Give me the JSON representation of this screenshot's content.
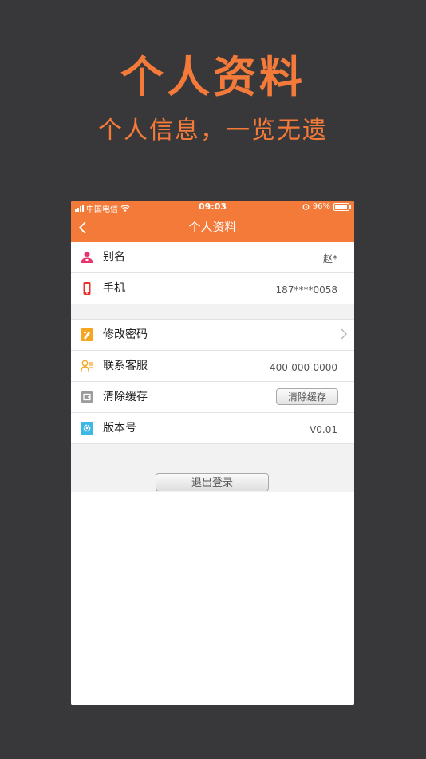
{
  "promo": {
    "title": "个人资料",
    "subtitle": "个人信息，一览无遗"
  },
  "status_bar": {
    "carrier": "中国电信",
    "time": "09:03",
    "battery": "96%",
    "battery_level": 0.96
  },
  "nav": {
    "title": "个人资料",
    "back_icon": "chevron-left-icon"
  },
  "profile": [
    {
      "label": "别名",
      "value": "赵*",
      "icon": "user-icon"
    },
    {
      "label": "手机",
      "value": "187****0058",
      "icon": "phone-icon"
    }
  ],
  "settings": {
    "change_password": {
      "label": "修改密码",
      "icon": "pencil-icon"
    },
    "customer_service": {
      "label": "联系客服",
      "value": "400-000-0000",
      "icon": "contact-icon"
    },
    "clear_cache": {
      "label": "清除缓存",
      "button": "清除缓存",
      "icon": "cache-icon"
    },
    "version": {
      "label": "版本号",
      "value": "V0.01",
      "icon": "gear-icon"
    }
  },
  "logout_label": "退出登录",
  "colors": {
    "accent": "#f47a3a",
    "background": "#38383a",
    "divider": "#e2e2e2",
    "section_bg": "#f2f2f2"
  }
}
